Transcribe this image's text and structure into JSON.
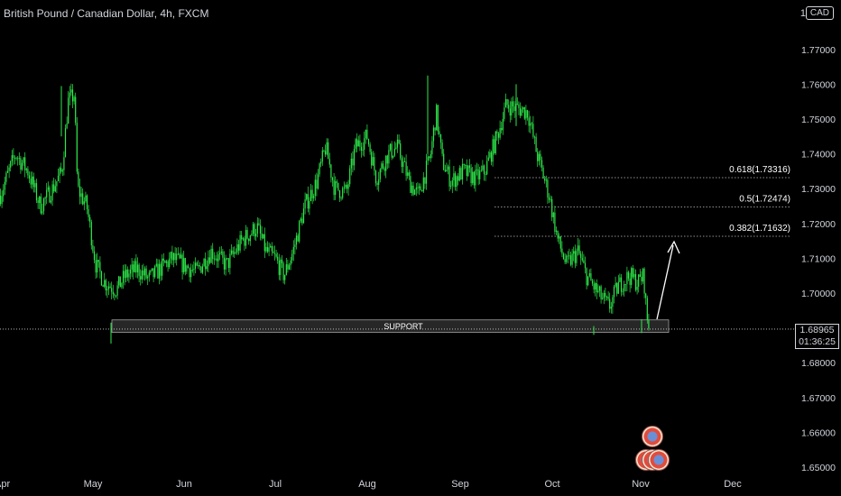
{
  "header": {
    "title": "British Pound / Canadian Dollar, 4h, FXCM",
    "currency_prefix": "1.",
    "currency": "CAD"
  },
  "price_tag": {
    "price": "1.68965",
    "countdown": "01:36:25"
  },
  "annotations": {
    "support_label": "SUPPORT",
    "fib": [
      {
        "label": "0.618(1.73316)",
        "price": 1.73316
      },
      {
        "label": "0.5(1.72474)",
        "price": 1.72474
      },
      {
        "label": "0.382(1.71632)",
        "price": 1.71632
      }
    ]
  },
  "colors": {
    "background": "#000000",
    "candle": "#2ee84a",
    "text": "#d1d4dc"
  },
  "chart_data": {
    "type": "candlestick",
    "title": "British Pound / Canadian Dollar, 4h, FXCM",
    "x_ticks": [
      "Apr",
      "May",
      "Jun",
      "Jul",
      "Aug",
      "Sep",
      "Oct",
      "Nov",
      "Dec"
    ],
    "y_ticks": [
      "1.77000",
      "1.76000",
      "1.75000",
      "1.74000",
      "1.73000",
      "1.72000",
      "1.71000",
      "1.70000",
      "1.68000",
      "1.67000",
      "1.66000",
      "1.65000"
    ],
    "ylim": [
      1.648,
      1.782
    ],
    "current_price": 1.68965,
    "support_zone": {
      "from": 1.6887,
      "to": 1.6923
    },
    "approx_closes": [
      {
        "d": "2022-04-01",
        "v": 1.728
      },
      {
        "d": "2022-04-06",
        "v": 1.74
      },
      {
        "d": "2022-04-10",
        "v": 1.735
      },
      {
        "d": "2022-04-14",
        "v": 1.725
      },
      {
        "d": "2022-04-18",
        "v": 1.73
      },
      {
        "d": "2022-04-21",
        "v": 1.735
      },
      {
        "d": "2022-04-23",
        "v": 1.755
      },
      {
        "d": "2022-04-25",
        "v": 1.757
      },
      {
        "d": "2022-04-26",
        "v": 1.73
      },
      {
        "d": "2022-04-29",
        "v": 1.725
      },
      {
        "d": "2022-05-02",
        "v": 1.708
      },
      {
        "d": "2022-05-05",
        "v": 1.703
      },
      {
        "d": "2022-05-09",
        "v": 1.701
      },
      {
        "d": "2022-05-12",
        "v": 1.705
      },
      {
        "d": "2022-05-16",
        "v": 1.707
      },
      {
        "d": "2022-05-20",
        "v": 1.704
      },
      {
        "d": "2022-05-24",
        "v": 1.707
      },
      {
        "d": "2022-05-28",
        "v": 1.71
      },
      {
        "d": "2022-06-01",
        "v": 1.708
      },
      {
        "d": "2022-06-05",
        "v": 1.706
      },
      {
        "d": "2022-06-10",
        "v": 1.712
      },
      {
        "d": "2022-06-15",
        "v": 1.708
      },
      {
        "d": "2022-06-20",
        "v": 1.715
      },
      {
        "d": "2022-06-25",
        "v": 1.719
      },
      {
        "d": "2022-06-28",
        "v": 1.712
      },
      {
        "d": "2022-07-01",
        "v": 1.71
      },
      {
        "d": "2022-07-04",
        "v": 1.705
      },
      {
        "d": "2022-07-07",
        "v": 1.712
      },
      {
        "d": "2022-07-11",
        "v": 1.725
      },
      {
        "d": "2022-07-15",
        "v": 1.732
      },
      {
        "d": "2022-07-18",
        "v": 1.742
      },
      {
        "d": "2022-07-21",
        "v": 1.73
      },
      {
        "d": "2022-07-25",
        "v": 1.729
      },
      {
        "d": "2022-07-28",
        "v": 1.742
      },
      {
        "d": "2022-08-01",
        "v": 1.745
      },
      {
        "d": "2022-08-04",
        "v": 1.733
      },
      {
        "d": "2022-08-08",
        "v": 1.74
      },
      {
        "d": "2022-08-11",
        "v": 1.742
      },
      {
        "d": "2022-08-15",
        "v": 1.732
      },
      {
        "d": "2022-08-18",
        "v": 1.728
      },
      {
        "d": "2022-08-22",
        "v": 1.739
      },
      {
        "d": "2022-08-24",
        "v": 1.752
      },
      {
        "d": "2022-08-26",
        "v": 1.738
      },
      {
        "d": "2022-08-29",
        "v": 1.732
      },
      {
        "d": "2022-09-02",
        "v": 1.735
      },
      {
        "d": "2022-09-06",
        "v": 1.733
      },
      {
        "d": "2022-09-09",
        "v": 1.735
      },
      {
        "d": "2022-09-13",
        "v": 1.745
      },
      {
        "d": "2022-09-16",
        "v": 1.754
      },
      {
        "d": "2022-09-20",
        "v": 1.753
      },
      {
        "d": "2022-09-23",
        "v": 1.752
      },
      {
        "d": "2022-09-26",
        "v": 1.74
      },
      {
        "d": "2022-09-30",
        "v": 1.728
      },
      {
        "d": "2022-10-03",
        "v": 1.715
      },
      {
        "d": "2022-10-06",
        "v": 1.708
      },
      {
        "d": "2022-10-10",
        "v": 1.712
      },
      {
        "d": "2022-10-13",
        "v": 1.705
      },
      {
        "d": "2022-10-17",
        "v": 1.7
      },
      {
        "d": "2022-10-21",
        "v": 1.696
      },
      {
        "d": "2022-10-24",
        "v": 1.702
      },
      {
        "d": "2022-10-28",
        "v": 1.705
      },
      {
        "d": "2022-10-31",
        "v": 1.703
      },
      {
        "d": "2022-11-02",
        "v": 1.705
      },
      {
        "d": "2022-11-03",
        "v": 1.693
      },
      {
        "d": "2022-11-04",
        "v": 1.68965
      }
    ]
  }
}
